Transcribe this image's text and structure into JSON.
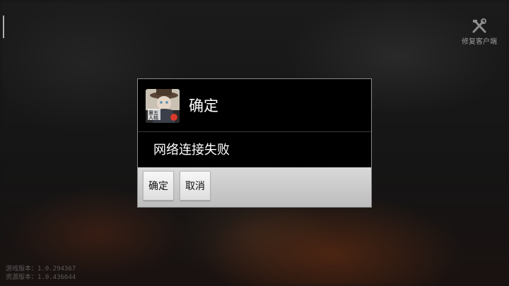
{
  "repair_client": {
    "label": "修复客户端",
    "icon": "tools-icon"
  },
  "version_info": {
    "game_version": "游戏版本：1.0.294367",
    "resource_version": "资源版本：1.0.436644"
  },
  "dialog": {
    "title": "确定",
    "message": "网络连接失败",
    "app_icon": {
      "name": "app-icon",
      "caption": "第五人格"
    },
    "buttons": {
      "ok": "确定",
      "cancel": "取消"
    }
  },
  "colors": {
    "dialog_bg": "#000000",
    "button_bar": "#c8c8c8",
    "text": "#ffffff"
  }
}
